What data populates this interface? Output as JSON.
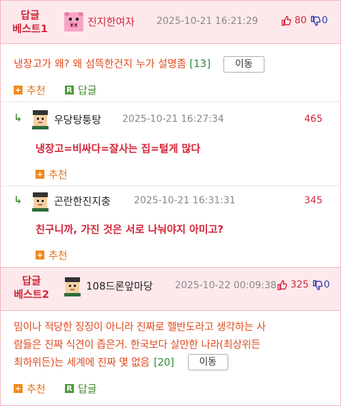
{
  "post1": {
    "best_label_1": "답글",
    "best_label_2": "베스트1",
    "nickname": "진지한여자",
    "date": "2025-10-21 16:21:29",
    "up": "80",
    "down": "0",
    "title": "냉장고가 왜? 왜 섬뜩한건지 누가 설명좀",
    "count": "[13]",
    "move_label": "이동",
    "recommend_label": "추천",
    "reply_label": "답글"
  },
  "reply1": {
    "nickname": "우당탕퉁탕",
    "date": "2025-10-21 16:27:34",
    "score": "465",
    "body": "냉장고=비싸다=잘사는 집=털게 많다",
    "recommend_label": "추천"
  },
  "reply2": {
    "nickname": "곤란한진지충",
    "date": "2025-10-21 16:31:31",
    "score": "345",
    "body": "친구니까, 가진 것은 서로 나눠야지 아미고?",
    "recommend_label": "추천"
  },
  "post2": {
    "best_label_1": "답글",
    "best_label_2": "베스트2",
    "nickname": "108드론앞마당",
    "date": "2025-10-22 00:09:38",
    "up": "325",
    "down": "0",
    "body_line1": "밈이나 적당한 징징이 아니라 진짜로 헬반도라고 생각하는 사",
    "body_line2": "람들은 진짜 식견이 좁은거. 한국보다 살만한 나라(최상위든",
    "body_line3": "최하위든)는 세계에 진짜 몇 없음",
    "count": "[20]",
    "move_label": "이동",
    "recommend_label": "추천",
    "reply_label": "답글"
  },
  "colors": {
    "header_bg": "#fde9ec",
    "accent_red": "#d42438",
    "body_orange": "#e04a1f",
    "count_green": "#2e8b3a",
    "recommend_orange": "#f08a1c",
    "reply_green": "#4a9a3a"
  },
  "icons": {
    "avatar1": "pink-pig-avatar",
    "avatar_default": "pixel-head-avatar",
    "thumb_up": "thumb-up-icon",
    "thumb_down": "thumb-down-icon",
    "reply_arrow": "reply-arrow-icon",
    "recommend": "plus-icon",
    "reply": "r-icon"
  }
}
